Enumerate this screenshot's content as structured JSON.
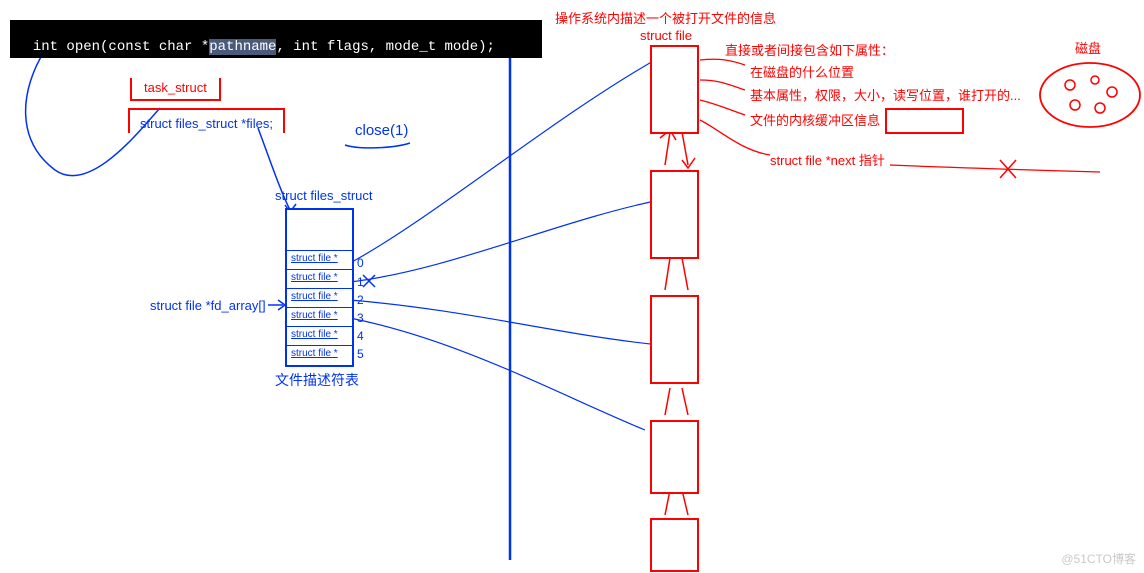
{
  "code": {
    "line1": "int open(const char *",
    "line1_hl": "pathname",
    "line1_rest": ", int flags, mode_t mode);"
  },
  "left": {
    "task_struct": "task_struct",
    "files_member": "struct files_struct *files;",
    "close1": "close(1)",
    "files_struct_label": "struct files_struct",
    "fd_array_label": "struct file *fd_array[]",
    "fd_rows": [
      "struct file *",
      "struct file *",
      "struct file *",
      "struct file *",
      "struct file *",
      "struct file *"
    ],
    "fd_indices": [
      "0",
      "1",
      "2",
      "3",
      "4",
      "5"
    ],
    "fd_table_caption": "文件描述符表"
  },
  "right": {
    "title": "操作系统内描述一个被打开文件的信息",
    "struct_file": "struct file",
    "attrs_title": "直接或者间接包含如下属性：",
    "attr1": "在磁盘的什么位置",
    "attr2": "基本属性，权限，大小，读写位置，谁打开的...",
    "attr3": "文件的内核缓冲区信息",
    "next_ptr": "struct file *next 指针",
    "disk": "磁盘"
  },
  "watermark": "@51CTO博客"
}
